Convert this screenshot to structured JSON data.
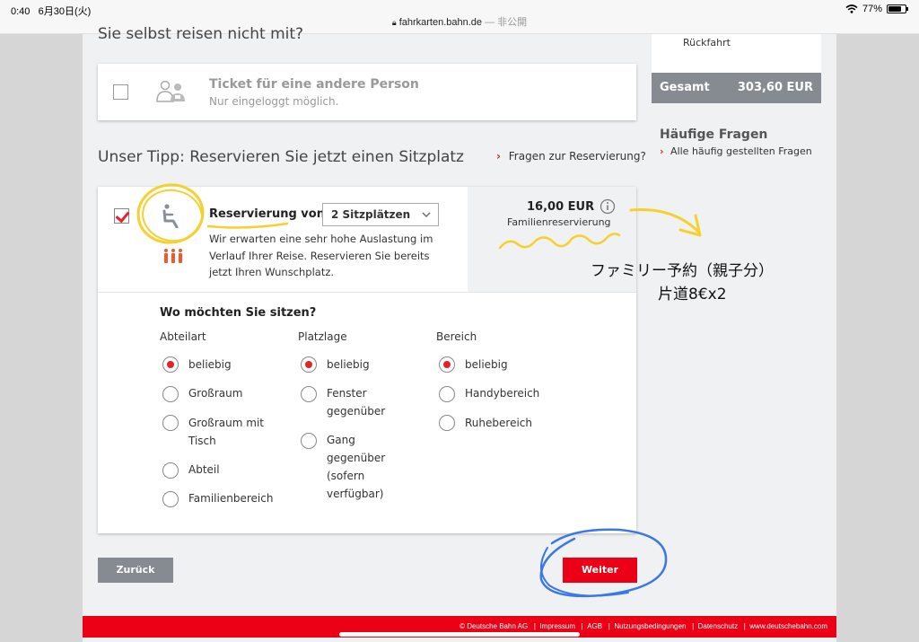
{
  "status": {
    "time": "0:40",
    "date": "6月30日(火)",
    "url": "fahrkarten.bahn.de",
    "url_suffix": "— 非公開",
    "battery": "77%"
  },
  "top_heading": "Sie selbst reisen nicht mit?",
  "other_person": {
    "title": "Ticket für eine andere Person",
    "subtitle": "Nur eingeloggt möglich."
  },
  "sidebar": {
    "return_label": "Rückfahrt",
    "total_label": "Gesamt",
    "total_value": "303,60 EUR",
    "faq_title": "Häufige Fragen",
    "faq_link": "Alle häufig gestellten Fragen"
  },
  "tip": {
    "heading": "Unser Tipp: Reservieren Sie jetzt einen Sitzplatz",
    "faq_link": "Fragen zur Reservierung?"
  },
  "reservation": {
    "label": "Reservierung von",
    "select_value": "2 Sitzplätzen",
    "desc_line1": "Wir erwarten eine sehr hohe Auslastung im",
    "desc_line2": "Verlauf Ihrer Reise. Reservieren Sie bereits",
    "desc_line3": "jetzt Ihren Wunschplatz.",
    "price": "16,00 EUR",
    "price_type": "Familienreservierung"
  },
  "seat_prefs": {
    "title": "Wo möchten Sie sitzen?",
    "columns": [
      {
        "heading": "Abteilart",
        "options": [
          {
            "lines": [
              "beliebig"
            ],
            "selected": true
          },
          {
            "lines": [
              "Großraum"
            ],
            "selected": false
          },
          {
            "lines": [
              "Großraum mit",
              "Tisch"
            ],
            "selected": false
          },
          {
            "lines": [
              "Abteil"
            ],
            "selected": false
          },
          {
            "lines": [
              "Familienbereich"
            ],
            "selected": false
          }
        ]
      },
      {
        "heading": "Platzlage",
        "options": [
          {
            "lines": [
              "beliebig"
            ],
            "selected": true
          },
          {
            "lines": [
              "Fenster",
              "gegenüber"
            ],
            "selected": false
          },
          {
            "lines": [
              "Gang",
              "gegenüber",
              "(sofern",
              "verfügbar)"
            ],
            "selected": false
          }
        ]
      },
      {
        "heading": "Bereich",
        "options": [
          {
            "lines": [
              "beliebig"
            ],
            "selected": true
          },
          {
            "lines": [
              "Handybereich"
            ],
            "selected": false
          },
          {
            "lines": [
              "Ruhebereich"
            ],
            "selected": false
          }
        ]
      }
    ]
  },
  "buttons": {
    "back": "Zurück",
    "next": "Weiter"
  },
  "footer": {
    "copyright": "© Deutsche Bahn AG",
    "links": [
      "Impressum",
      "AGB",
      "Nutzungsbedingungen",
      "Datenschutz",
      "www.deutschebahn.com"
    ]
  },
  "annotation": {
    "line1": "ファミリー予約（親子分）",
    "line2": "片道8€x2"
  },
  "colors": {
    "db_red": "#ec0016",
    "grey_bar": "#858b91",
    "marker_yellow": "#f5d02f",
    "marker_blue": "#3b78e7"
  }
}
